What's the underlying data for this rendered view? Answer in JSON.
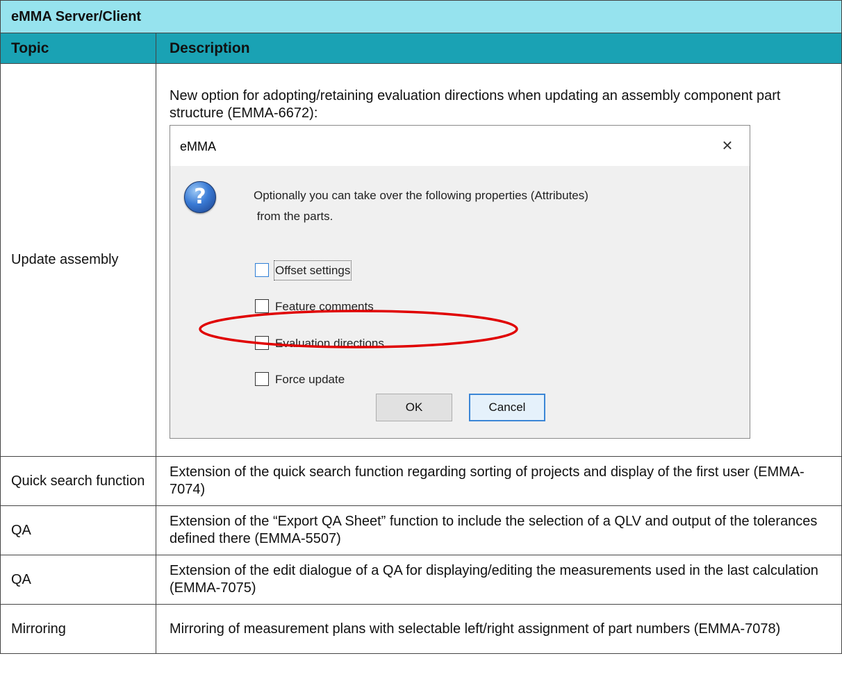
{
  "table": {
    "title": "eMMA Server/Client",
    "headers": {
      "topic": "Topic",
      "description": "Description"
    },
    "rows": [
      {
        "topic": "Update assembly",
        "description": "New option for adopting/retaining evaluation directions when updating an assembly component part structure (EMMA-6672):"
      },
      {
        "topic": "Quick search function",
        "description": "Extension of the quick search function regarding sorting of projects and display of the first user (EMMA-7074)"
      },
      {
        "topic": "QA",
        "description": "Extension of the “Export QA Sheet” function to include the selection of a QLV and output of the tolerances defined there (EMMA-5507)"
      },
      {
        "topic": "QA",
        "description": "Extension of the edit dialogue of a QA for displaying/editing the measurements used in the last calculation (EMMA-7075)"
      },
      {
        "topic": "Mirroring",
        "description": "Mirroring of measurement plans with selectable left/right assignment of part numbers (EMMA-7078)"
      }
    ]
  },
  "dialog": {
    "title": "eMMA",
    "close_glyph": "×",
    "icon": "question-icon",
    "message_line1": "Optionally you can take over the following properties (Attributes)",
    "message_line2": " from the parts.",
    "options": [
      {
        "label": "Offset settings",
        "checked": false
      },
      {
        "label": "Feature comments",
        "checked": false
      },
      {
        "label": "Evaluation directions",
        "checked": false,
        "highlighted": true
      },
      {
        "label": "Force update",
        "checked": false
      }
    ],
    "ok_label": "OK",
    "cancel_label": "Cancel"
  },
  "colors": {
    "title_bg": "#96e3ee",
    "header_bg": "#1aa2b4",
    "highlight_ellipse": "#e00000"
  }
}
